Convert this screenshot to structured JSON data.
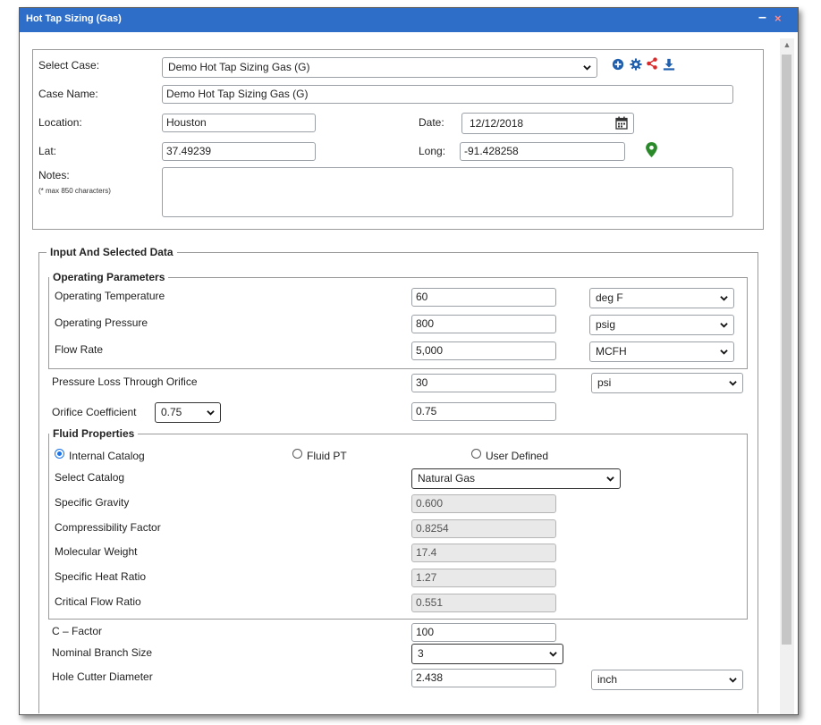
{
  "window": {
    "title": "Hot Tap Sizing (Gas)",
    "minimize": "–",
    "close": "×"
  },
  "case": {
    "select_case_label": "Select Case:",
    "select_case_value": "Demo Hot Tap Sizing Gas (G)",
    "case_name_label": "Case Name:",
    "case_name_value": "Demo Hot Tap Sizing Gas (G)",
    "location_label": "Location:",
    "location_value": "Houston",
    "date_label": "Date:",
    "date_value": "12/12/2018",
    "lat_label": "Lat:",
    "lat_value": "37.49239",
    "long_label": "Long:",
    "long_value": "-91.428258",
    "notes_label": "Notes:",
    "notes_hint": "(* max 850 characters)",
    "notes_value": ""
  },
  "icons": {
    "add": "plus-circle-icon",
    "settings": "gear-icon",
    "share": "share-icon",
    "download": "download-icon",
    "calendar": "calendar-icon",
    "map": "map-pin-icon"
  },
  "colors": {
    "title_bar": "#2e6ec9",
    "icon_blue": "#1f5fae",
    "share_red": "#d92b2b",
    "pin_green": "#2a8a2a",
    "radio_selected": "#1a73e8"
  },
  "input_section": {
    "legend": "Input And Selected Data",
    "operating": {
      "legend": "Operating Parameters",
      "temperature_label": "Operating Temperature",
      "temperature_value": "60",
      "temperature_unit": "deg F",
      "pressure_label": "Operating Pressure",
      "pressure_value": "800",
      "pressure_unit": "psig",
      "flow_label": "Flow Rate",
      "flow_value": "5,000",
      "flow_unit": "MCFH"
    },
    "pressure_loss_label": "Pressure Loss Through Orifice",
    "pressure_loss_value": "30",
    "pressure_loss_unit": "psi",
    "orifice_label": "Orifice Coefficient",
    "orifice_select": "0.75",
    "orifice_value": "0.75",
    "fluid": {
      "legend": "Fluid Properties",
      "radio_internal": "Internal Catalog",
      "radio_fluid_pt": "Fluid PT",
      "radio_user": "User Defined",
      "catalog_label": "Select Catalog",
      "catalog_value": "Natural Gas",
      "sg_label": "Specific Gravity",
      "sg_value": "0.600",
      "z_label": "Compressibility Factor",
      "z_value": "0.8254",
      "mw_label": "Molecular Weight",
      "mw_value": "17.4",
      "k_label": "Specific Heat Ratio",
      "k_value": "1.27",
      "cfr_label": "Critical Flow Ratio",
      "cfr_value": "0.551"
    },
    "c_factor_label": "C – Factor",
    "c_factor_value": "100",
    "branch_label": "Nominal Branch Size",
    "branch_value": "3",
    "cutter_label": "Hole Cutter Diameter",
    "cutter_value": "2.438",
    "cutter_unit": "inch"
  }
}
